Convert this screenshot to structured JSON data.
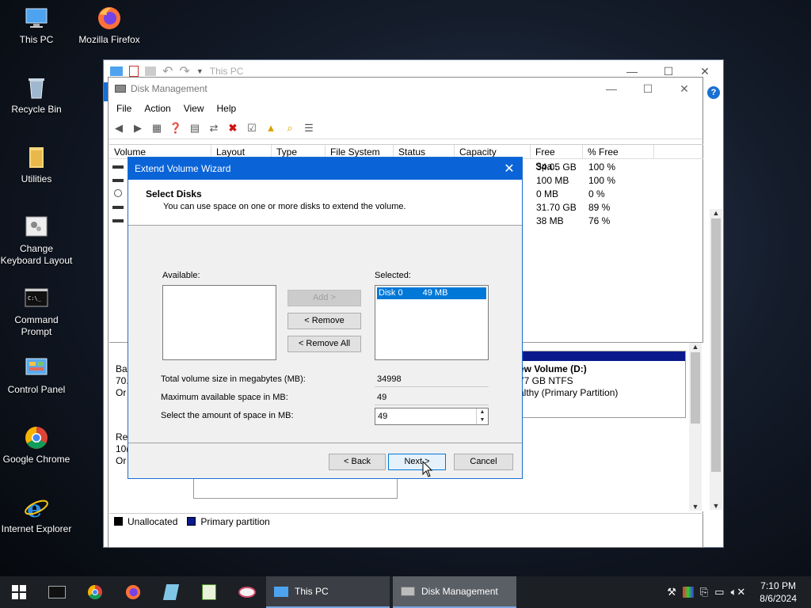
{
  "desktop": {
    "icons": [
      {
        "label": "This PC"
      },
      {
        "label": "Mozilla Firefox"
      },
      {
        "label": "Recycle Bin"
      },
      {
        "label": "Utilities"
      },
      {
        "label": "Change Keyboard Layout"
      },
      {
        "label": "Command Prompt"
      },
      {
        "label": "Control Panel"
      },
      {
        "label": "Google Chrome"
      },
      {
        "label": "Internet Explorer"
      }
    ]
  },
  "thispc_window": {
    "title": "This PC"
  },
  "disk_mgmt": {
    "title": "Disk Management",
    "menu": [
      "File",
      "Action",
      "View",
      "Help"
    ],
    "columns": [
      "Volume",
      "Layout",
      "Type",
      "File System",
      "Status",
      "Capacity",
      "Free Spa...",
      "% Free"
    ],
    "rows": [
      {
        "free": "34.05 GB",
        "pct": "100 %"
      },
      {
        "free": "100 MB",
        "pct": "100 %"
      },
      {
        "free": "0 MB",
        "pct": "0 %"
      },
      {
        "free": "31.70 GB",
        "pct": "89 %"
      },
      {
        "free": "38 MB",
        "pct": "76 %"
      }
    ],
    "lower_left": {
      "disk0_a": "Ba",
      "disk0_b": "70.",
      "disk0_c": "Or",
      "disk1_a": "Re",
      "disk1_b": "10(",
      "disk1_c": "Or"
    },
    "partition": {
      "name": "ew Volume  (D:)",
      "size": "77 GB NTFS",
      "status": "althy (Primary Partition)"
    },
    "legend": {
      "unallocated": "Unallocated",
      "primary": "Primary partition"
    }
  },
  "dialog": {
    "title": "Extend Volume Wizard",
    "heading": "Select Disks",
    "subheading": "You can use space on one or more disks to extend the volume.",
    "available_label": "Available:",
    "selected_label": "Selected:",
    "selected_items": [
      {
        "disk": "Disk 0",
        "size": "49 MB"
      }
    ],
    "add_button": "Add >",
    "remove_button": "< Remove",
    "remove_all_button": "< Remove All",
    "total_label": "Total volume size in megabytes (MB):",
    "total_value": "34998",
    "max_label": "Maximum available space in MB:",
    "max_value": "49",
    "amount_label": "Select the amount of space in MB:",
    "amount_value": "49",
    "back_button": "< Back",
    "next_button": "Next >",
    "cancel_button": "Cancel"
  },
  "taskbar": {
    "tasks": [
      {
        "label": "This PC"
      },
      {
        "label": "Disk Management"
      }
    ],
    "time": "7:10 PM",
    "date": "8/6/2024"
  },
  "colors": {
    "accent": "#0a64d8",
    "selected_item": "#0078d7",
    "taskbar": "#1c1f24"
  }
}
